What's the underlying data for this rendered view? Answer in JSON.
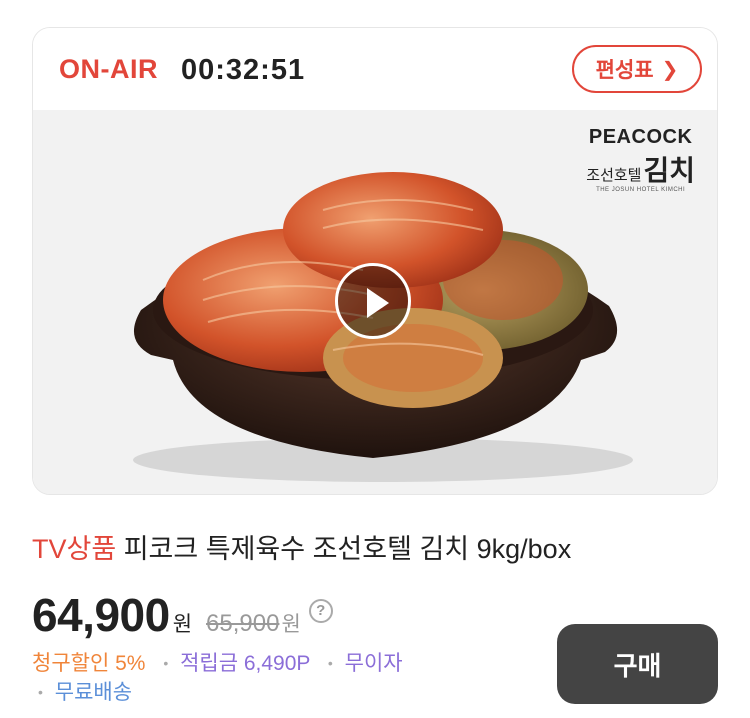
{
  "live": {
    "status_label": "ON-AIR",
    "timer": "00:32:51",
    "schedule_button": "편성표"
  },
  "media": {
    "brand_name": "PEACOCK",
    "brand_sub_small": "조선호텔",
    "brand_sub_big": "김치",
    "brand_tagline": "THE JOSUN HOTEL KIMCHI"
  },
  "product": {
    "tag": "TV상품",
    "name": "피코크 특제육수 조선호텔 김치 9kg/box",
    "price": "64,900",
    "currency": "원",
    "original_price": "65,900",
    "original_currency": "원",
    "help_label": "?"
  },
  "benefits": {
    "discount": "청구할인 5%",
    "points": "적립금 6,490P",
    "installment": "무이자",
    "shipping": "무료배송"
  },
  "actions": {
    "buy_label": "구매"
  },
  "colors": {
    "accent": "#e2463a",
    "discount": "#f0853a",
    "points": "#8b6ed8",
    "shipping": "#5b8fd8",
    "buy_button": "#444444"
  }
}
